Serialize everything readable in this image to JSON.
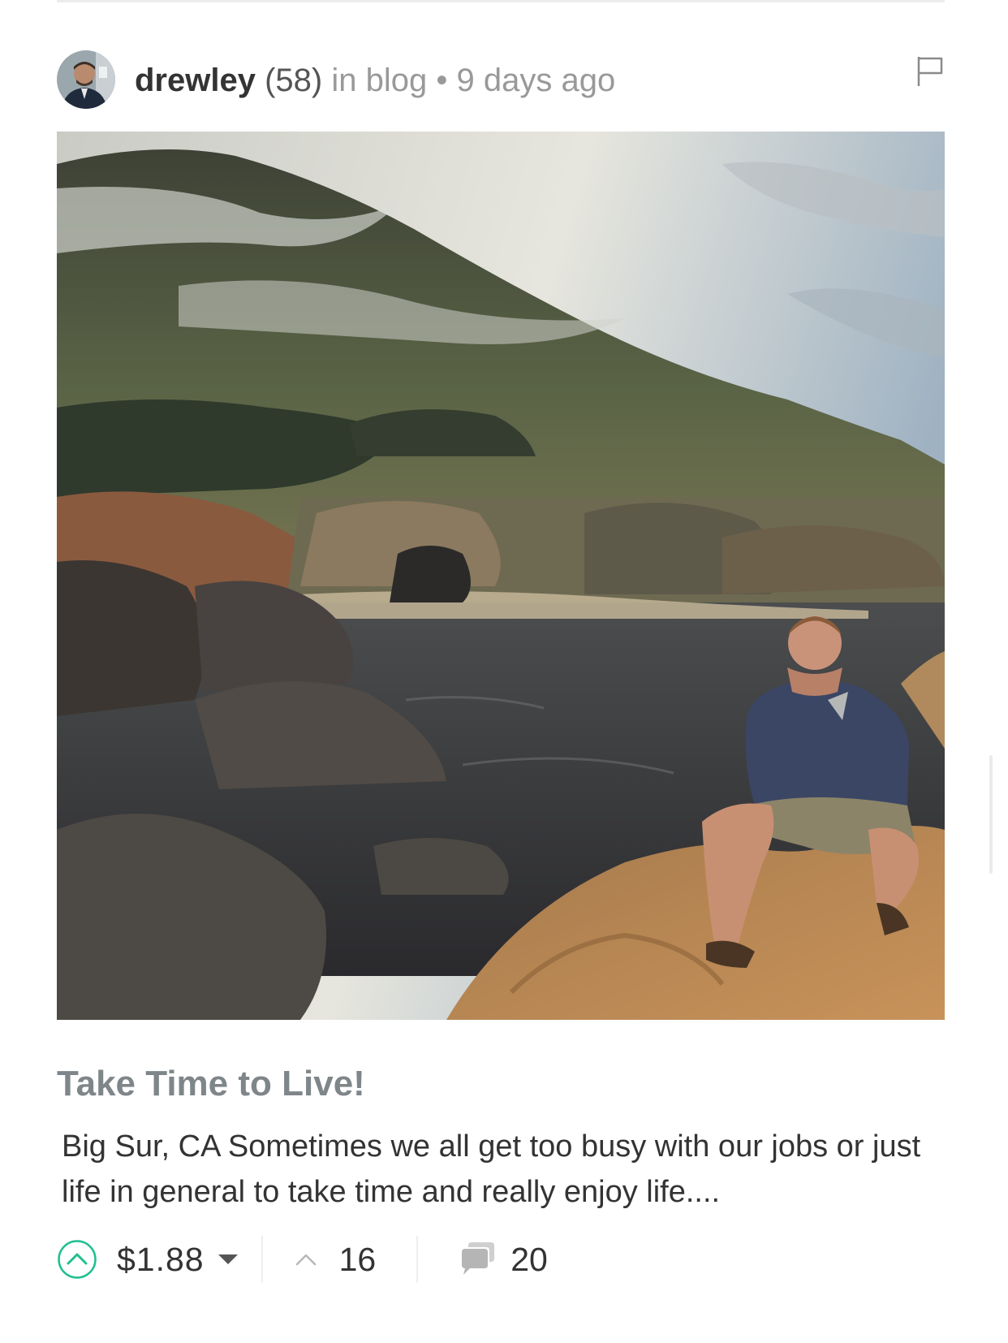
{
  "author": {
    "name": "drewley",
    "reputation": "(58)",
    "context": "in blog",
    "separator": "•",
    "timestamp": "9 days ago",
    "avatar_icon": "user-avatar"
  },
  "post": {
    "title": "Take Time to Live!",
    "summary": "Big Sur, CA Sometimes we all get too busy with our jobs or just life in general to take time and really enjoy life....",
    "image_alt": "Big Sur, CA"
  },
  "footer": {
    "payout": "$1.88",
    "votes": "16",
    "comments": "20"
  },
  "icons": {
    "flag": "flag-icon",
    "upvote": "upvote-circle-icon",
    "payout_dropdown": "caret-down-icon",
    "votes": "chevron-up-icon",
    "comments": "comments-icon"
  },
  "colors": {
    "upvote_accent": "#1fbf8f",
    "title": "#7f868a",
    "muted_text": "#999999"
  }
}
